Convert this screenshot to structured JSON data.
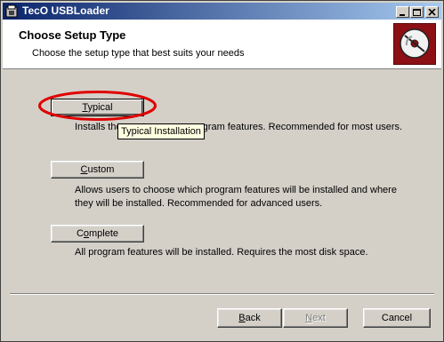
{
  "window": {
    "title": "TecO USBLoader",
    "buttons": {
      "minimize_icon": "minimize-icon",
      "maximize_icon": "maximize-icon",
      "close_icon": "close-icon"
    }
  },
  "header": {
    "title": "Choose Setup Type",
    "subtitle": "Choose the setup type that best suits your needs"
  },
  "options": [
    {
      "pre": "",
      "accel": "T",
      "post": "ypical",
      "description_lines": [
        "Installs the most common program features. Recommended for most users."
      ]
    },
    {
      "pre": "",
      "accel": "C",
      "post": "ustom",
      "description_lines": [
        "Allows users to choose which program features will be installed and where",
        "they will be installed. Recommended for advanced users."
      ]
    },
    {
      "pre": "C",
      "accel": "o",
      "post": "mplete",
      "description_lines": [
        "All program features will be installed. Requires the most disk space."
      ]
    }
  ],
  "tooltip": "Typical Installation",
  "footer": {
    "back": {
      "accel": "B",
      "post": "ack"
    },
    "next": {
      "accel": "N",
      "post": "ext"
    },
    "cancel": "Cancel"
  },
  "colors": {
    "titlebar_start": "#0a246a",
    "titlebar_end": "#a6caf0",
    "highlight_ring": "#e00000",
    "logo_bg": "#8b0f14"
  }
}
